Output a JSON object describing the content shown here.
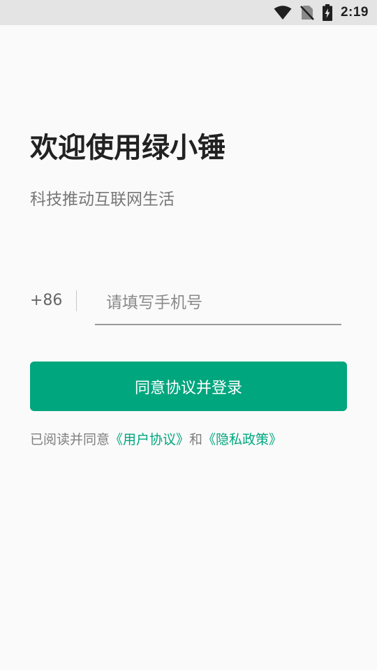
{
  "status_bar": {
    "time": "2:19",
    "icons": [
      "wifi-icon",
      "no-sim-icon",
      "battery-charging-icon"
    ]
  },
  "welcome": {
    "title": "欢迎使用绿小锤",
    "subtitle": "科技推动互联网生活"
  },
  "phone": {
    "country_code": "+86",
    "placeholder": "请填写手机号",
    "value": ""
  },
  "login_button": {
    "label": "同意协议并登录"
  },
  "agreement": {
    "prefix": "已阅读并同意",
    "user_agreement": "《用户协议》",
    "conjunction": "和",
    "privacy_policy": "《隐私政策》"
  },
  "colors": {
    "accent": "#00a67e",
    "background": "#fafafa",
    "status_bar": "#e4e4e4"
  }
}
